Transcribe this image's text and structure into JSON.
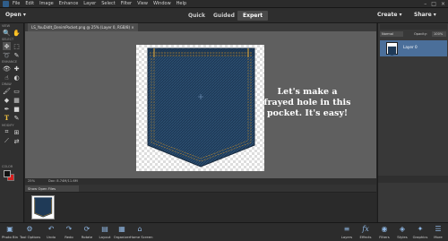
{
  "menubar": {
    "items": [
      "File",
      "Edit",
      "Image",
      "Enhance",
      "Layer",
      "Select",
      "Filter",
      "View",
      "Window",
      "Help"
    ],
    "window_controls": [
      "–",
      "□",
      "×"
    ]
  },
  "modebar": {
    "open_label": "Open ▾",
    "tabs": [
      {
        "label": "Quick"
      },
      {
        "label": "Guided"
      },
      {
        "label": "Expert"
      }
    ],
    "create_label": "Create ▾",
    "share_label": "Share ▾"
  },
  "toolbox": {
    "sections": [
      "VIEW",
      "SELECT",
      "ENHANCE",
      "DRAW",
      "MODIFY",
      "COLOR"
    ],
    "tools": {
      "zoom": "🔍",
      "hand": "✋",
      "move": "✥",
      "marquee": "⬚",
      "lasso": "➰",
      "quick_select": "✎",
      "eye": "👁",
      "spot": "✚",
      "smudge": "☝",
      "sponge": "◐",
      "brush": "🖌",
      "eraser": "▭",
      "bucket": "◆",
      "gradient": "▦",
      "eyedropper": "✒",
      "shape": "■",
      "text": "T",
      "pencil": "✎",
      "crop": "⌗",
      "recompose": "⊞",
      "straighten": "⟋",
      "content_move": "⇄"
    },
    "fg_color": "#111111",
    "bg_color": "#d81e1e"
  },
  "document": {
    "tab_label": "LS_YouDidIt_DenimPocket.png @ 25% (Layer 0, RGB/8) ×"
  },
  "canvas": {
    "caption": "Let's make a frayed hole in this pocket. It's easy!"
  },
  "status": {
    "zoom": "25%",
    "doc_info": "Doc: 8.74M/11.6M"
  },
  "photobin": {
    "select_label": "Show Open Files"
  },
  "layers": {
    "blend_mode": "Normal",
    "opacity_label": "Opacity:",
    "opacity_value": "100%",
    "layer_name": "Layer 0"
  },
  "bottombar": {
    "buttons": [
      {
        "label": "Photo Bin",
        "icon": "▣"
      },
      {
        "label": "Tool Options",
        "icon": "⚙"
      },
      {
        "label": "Undo",
        "icon": "↶"
      },
      {
        "label": "Redo",
        "icon": "↷"
      },
      {
        "label": "Rotate",
        "icon": "⟳"
      },
      {
        "label": "Layout",
        "icon": "▤"
      },
      {
        "label": "Organizer",
        "icon": "▦"
      },
      {
        "label": "Home Screen",
        "icon": "⌂"
      },
      {
        "label": "Layers",
        "icon": "≡"
      },
      {
        "label": "Effects",
        "icon": "fx"
      },
      {
        "label": "Filters",
        "icon": "◉"
      },
      {
        "label": "Styles",
        "icon": "◈"
      },
      {
        "label": "Graphics",
        "icon": "✦"
      },
      {
        "label": "More",
        "icon": "☰"
      }
    ]
  },
  "colors": {
    "accent": "#4b6f9a",
    "denim": "#1f3a57",
    "stitch": "#b9872e"
  }
}
